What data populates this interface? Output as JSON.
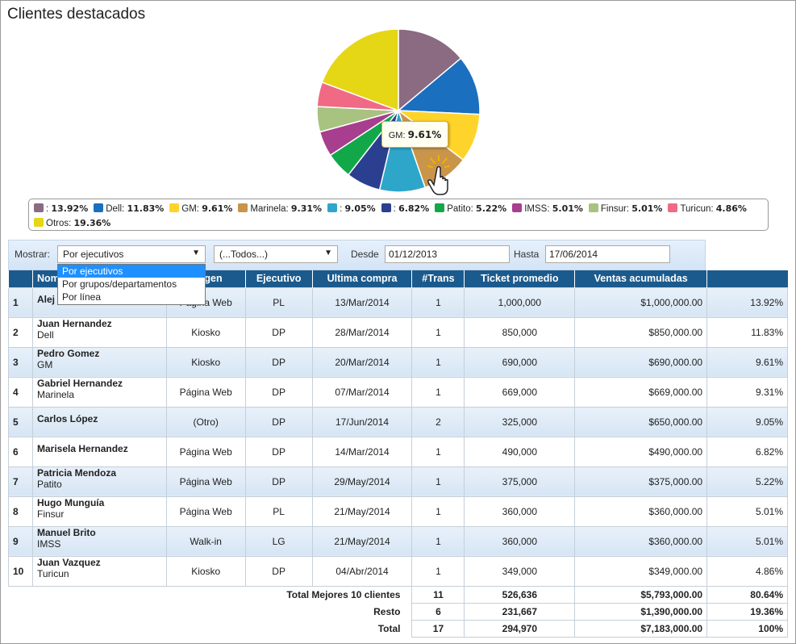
{
  "title": "Clientes destacados",
  "chart_data": {
    "type": "pie",
    "slices": [
      {
        "label": "",
        "value": 13.92,
        "color": "#8a6b82"
      },
      {
        "label": "Dell",
        "value": 11.83,
        "color": "#1a6fbf"
      },
      {
        "label": "GM",
        "value": 9.61,
        "color": "#ffd42a"
      },
      {
        "label": "Marinela",
        "value": 9.31,
        "color": "#c8954b"
      },
      {
        "label": "",
        "value": 9.05,
        "color": "#2ea6c9"
      },
      {
        "label": "",
        "value": 6.82,
        "color": "#2a3f8f"
      },
      {
        "label": "Patito",
        "value": 5.22,
        "color": "#12a84a"
      },
      {
        "label": "IMSS",
        "value": 5.01,
        "color": "#a83e8e"
      },
      {
        "label": "Finsur",
        "value": 5.01,
        "color": "#a8c27f"
      },
      {
        "label": "Turicun",
        "value": 4.86,
        "color": "#f06a85"
      },
      {
        "label": "Otros",
        "value": 19.36,
        "color": "#e5d616"
      }
    ]
  },
  "legend": [
    {
      "label": ":",
      "pct": "13.92%",
      "color": "#8a6b82"
    },
    {
      "label": "Dell:",
      "pct": "11.83%",
      "color": "#1a6fbf"
    },
    {
      "label": "GM:",
      "pct": "9.61%",
      "color": "#ffd42a"
    },
    {
      "label": "Marinela:",
      "pct": "9.31%",
      "color": "#c8954b"
    },
    {
      "label": ":",
      "pct": "9.05%",
      "color": "#2ea6c9"
    },
    {
      "label": ":",
      "pct": "6.82%",
      "color": "#2a3f8f"
    },
    {
      "label": "Patito:",
      "pct": "5.22%",
      "color": "#12a84a"
    },
    {
      "label": "IMSS:",
      "pct": "5.01%",
      "color": "#a83e8e"
    },
    {
      "label": "Finsur:",
      "pct": "5.01%",
      "color": "#a8c27f"
    },
    {
      "label": "Turicun:",
      "pct": "4.86%",
      "color": "#f06a85"
    },
    {
      "label": "Otros:",
      "pct": "19.36%",
      "color": "#e5d616"
    }
  ],
  "tooltip": {
    "label": "GM:",
    "value": "9.61%"
  },
  "filters": {
    "mostrar_label": "Mostrar:",
    "mostrar_value": "Por ejecutivos",
    "second_value": "(...Todos...)",
    "desde_label": "Desde",
    "desde_value": "01/12/2013",
    "hasta_label": "Hasta",
    "hasta_value": "17/06/2014",
    "options": [
      "Por ejecutivos",
      "Por grupos/departamentos",
      "Por línea"
    ]
  },
  "table": {
    "headers": [
      "",
      "Nom",
      "gen",
      "Ejecutivo",
      "Ultima compra",
      "#Trans",
      "Ticket promedio",
      "Ventas acumuladas",
      ""
    ],
    "rows": [
      {
        "n": "1",
        "name": "Alej",
        "sub": "",
        "origen": "Página Web",
        "ejec": "PL",
        "fecha": "13/Mar/2014",
        "trans": "1",
        "ticket": "1,000,000",
        "ventas": "$1,000,000.00",
        "pct": "13.92%"
      },
      {
        "n": "2",
        "name": "Juan Hernandez",
        "sub": "Dell",
        "origen": "Kiosko",
        "ejec": "DP",
        "fecha": "28/Mar/2014",
        "trans": "1",
        "ticket": "850,000",
        "ventas": "$850,000.00",
        "pct": "11.83%"
      },
      {
        "n": "3",
        "name": "Pedro Gomez",
        "sub": "GM",
        "origen": "Kiosko",
        "ejec": "DP",
        "fecha": "20/Mar/2014",
        "trans": "1",
        "ticket": "690,000",
        "ventas": "$690,000.00",
        "pct": "9.61%"
      },
      {
        "n": "4",
        "name": "Gabriel Hernandez",
        "sub": "Marinela",
        "origen": "Página Web",
        "ejec": "DP",
        "fecha": "07/Mar/2014",
        "trans": "1",
        "ticket": "669,000",
        "ventas": "$669,000.00",
        "pct": "9.31%"
      },
      {
        "n": "5",
        "name": "Carlos López",
        "sub": "",
        "origen": "(Otro)",
        "ejec": "DP",
        "fecha": "17/Jun/2014",
        "trans": "2",
        "ticket": "325,000",
        "ventas": "$650,000.00",
        "pct": "9.05%"
      },
      {
        "n": "6",
        "name": "Marisela Hernandez",
        "sub": "",
        "origen": "Página Web",
        "ejec": "DP",
        "fecha": "14/Mar/2014",
        "trans": "1",
        "ticket": "490,000",
        "ventas": "$490,000.00",
        "pct": "6.82%"
      },
      {
        "n": "7",
        "name": "Patricia Mendoza",
        "sub": "Patito",
        "origen": "Página Web",
        "ejec": "DP",
        "fecha": "29/May/2014",
        "trans": "1",
        "ticket": "375,000",
        "ventas": "$375,000.00",
        "pct": "5.22%"
      },
      {
        "n": "8",
        "name": "Hugo Munguía",
        "sub": "Finsur",
        "origen": "Página Web",
        "ejec": "PL",
        "fecha": "21/May/2014",
        "trans": "1",
        "ticket": "360,000",
        "ventas": "$360,000.00",
        "pct": "5.01%"
      },
      {
        "n": "9",
        "name": "Manuel Brito",
        "sub": "IMSS",
        "origen": "Walk-in",
        "ejec": "LG",
        "fecha": "21/May/2014",
        "trans": "1",
        "ticket": "360,000",
        "ventas": "$360,000.00",
        "pct": "5.01%"
      },
      {
        "n": "10",
        "name": "Juan Vazquez",
        "sub": "Turicun",
        "origen": "Kiosko",
        "ejec": "DP",
        "fecha": "04/Abr/2014",
        "trans": "1",
        "ticket": "349,000",
        "ventas": "$349,000.00",
        "pct": "4.86%"
      }
    ],
    "footer": [
      {
        "label": "Total Mejores 10 clientes",
        "trans": "11",
        "ticket": "526,636",
        "ventas": "$5,793,000.00",
        "pct": "80.64%"
      },
      {
        "label": "Resto",
        "trans": "6",
        "ticket": "231,667",
        "ventas": "$1,390,000.00",
        "pct": "19.36%"
      },
      {
        "label": "Total",
        "trans": "17",
        "ticket": "294,970",
        "ventas": "$7,183,000.00",
        "pct": "100%"
      }
    ]
  }
}
